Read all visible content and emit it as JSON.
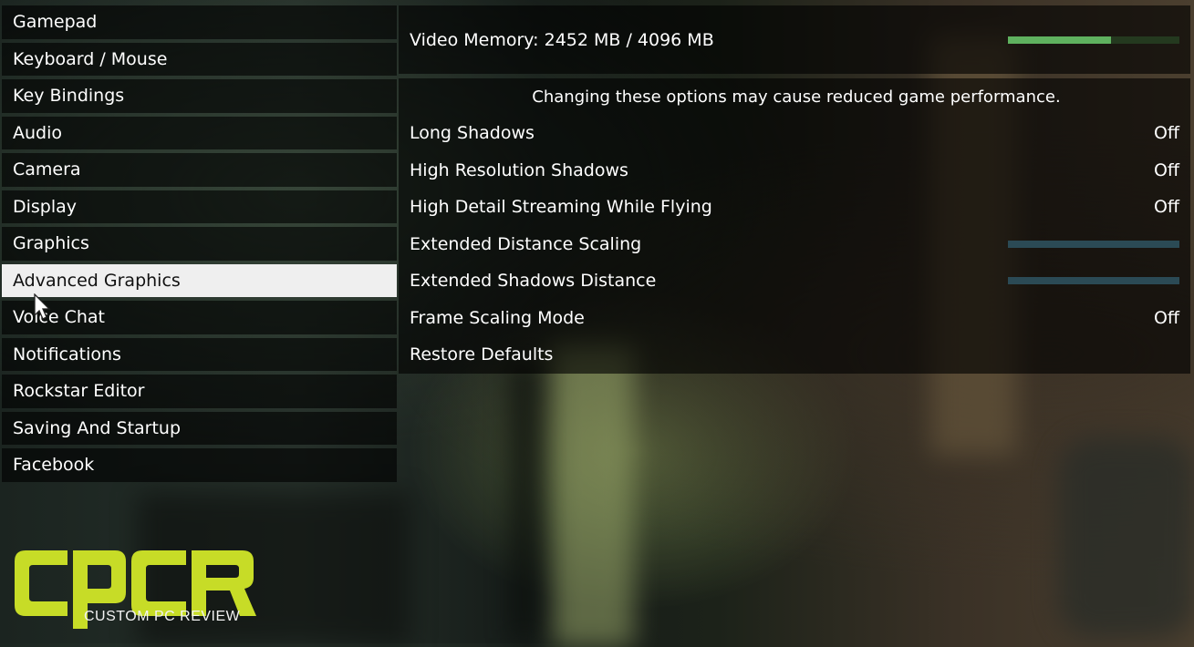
{
  "menu": {
    "items": [
      {
        "label": "Gamepad"
      },
      {
        "label": "Keyboard / Mouse"
      },
      {
        "label": "Key Bindings"
      },
      {
        "label": "Audio"
      },
      {
        "label": "Camera"
      },
      {
        "label": "Display"
      },
      {
        "label": "Graphics"
      },
      {
        "label": "Advanced Graphics",
        "selected": true
      },
      {
        "label": "Voice Chat"
      },
      {
        "label": "Notifications"
      },
      {
        "label": "Rockstar Editor"
      },
      {
        "label": "Saving And Startup"
      },
      {
        "label": "Facebook"
      }
    ]
  },
  "panel": {
    "video_memory_label": "Video Memory: 2452 MB / 4096 MB",
    "video_memory_used_fraction": 0.6,
    "warning": "Changing these options may cause reduced game performance.",
    "options": [
      {
        "label": "Long Shadows",
        "value": "Off"
      },
      {
        "label": "High Resolution Shadows",
        "value": "Off"
      },
      {
        "label": "High Detail Streaming While Flying",
        "value": "Off"
      },
      {
        "label": "Extended Distance Scaling",
        "slider_fraction": 0.0
      },
      {
        "label": "Extended Shadows Distance",
        "slider_fraction": 0.0
      },
      {
        "label": "Frame Scaling Mode",
        "value": "Off"
      },
      {
        "label": "Restore Defaults"
      }
    ]
  },
  "logo": {
    "letters": "cpcr",
    "subtitle": "CUSTOM PC REVIEW"
  },
  "colors": {
    "accent_green": "#5fb15f",
    "logo_yellow": "#c7dc27",
    "selected_bg": "#efefef"
  }
}
